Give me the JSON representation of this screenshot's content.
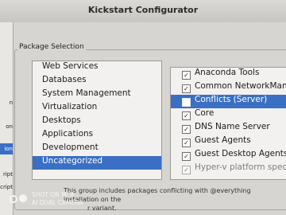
{
  "window": {
    "title": "Kickstart Configurator"
  },
  "left_strip": {
    "items": [
      {
        "label": "n"
      },
      {
        "label": "on"
      },
      {
        "label": "ion"
      },
      {
        "label": "ript"
      },
      {
        "label": "cript"
      }
    ]
  },
  "package_selection": {
    "section_label": "Package Selection",
    "groups": [
      {
        "label": "Web Services"
      },
      {
        "label": "Databases"
      },
      {
        "label": "System Management"
      },
      {
        "label": "Virtualization"
      },
      {
        "label": "Desktops"
      },
      {
        "label": "Applications"
      },
      {
        "label": "Development"
      },
      {
        "label": "Uncategorized"
      }
    ],
    "packages": [
      {
        "label": "Anaconda Tools",
        "check": "✓"
      },
      {
        "label": "Common NetworkManage",
        "check": "✓"
      },
      {
        "label": "Conflicts (Server)",
        "check": ""
      },
      {
        "label": "Core",
        "check": "✓"
      },
      {
        "label": "DNS Name Server",
        "check": "✓"
      },
      {
        "label": "Guest Agents",
        "check": "✓"
      },
      {
        "label": "Guest Desktop Agents",
        "check": "✓"
      },
      {
        "label": "Hyper-v platform specific se",
        "check": "✓"
      }
    ],
    "description_line1": "This group includes packages conflicting with @everything installation on the",
    "description_line2": "r variant."
  },
  "watermark": {
    "line1": "SHOT ON MI 8",
    "line2": "AI DUAL CAMERA"
  }
}
